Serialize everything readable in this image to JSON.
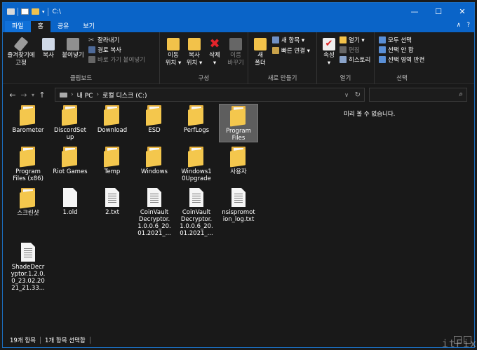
{
  "window": {
    "title": "C:\\",
    "controls": [
      "—",
      "☐",
      "✕"
    ]
  },
  "tabs": [
    {
      "label": "파일"
    },
    {
      "label": "홈"
    },
    {
      "label": "공유"
    },
    {
      "label": "보기"
    }
  ],
  "ribbon": {
    "clipboard": {
      "pin": "즐겨찾기에\n고정",
      "copy": "복사",
      "paste": "붙여넣기",
      "cut": "잘라내기",
      "copy_path": "경로 복사",
      "paste_shortcut": "바로 가기 붙여넣기",
      "label": "클립보드"
    },
    "organize": {
      "move_to": "이동\n위치 ▾",
      "copy_to": "복사\n위치 ▾",
      "delete": "삭제\n▾",
      "rename": "이름\n바꾸기",
      "label": "구성"
    },
    "new": {
      "new_folder": "새\n폴더",
      "new_item": "새 항목 ▾",
      "easy_access": "빠른 연결 ▾",
      "label": "새로 만들기"
    },
    "open": {
      "properties": "속성\n▾",
      "open": "열기 ▾",
      "edit": "편집",
      "history": "히스토리",
      "label": "열기"
    },
    "select": {
      "select_all": "모두 선택",
      "select_none": "선택 안 함",
      "invert": "선택 영역 반전",
      "label": "선택"
    }
  },
  "address": {
    "path_pc": "내 PC",
    "path_drive": "로컬 디스크 (C:)",
    "search_placeholder": ""
  },
  "items": [
    {
      "name": "Barometer",
      "type": "folder"
    },
    {
      "name": "DiscordSet\nup",
      "type": "folder"
    },
    {
      "name": "Download",
      "type": "folder"
    },
    {
      "name": "ESD",
      "type": "folder"
    },
    {
      "name": "PerfLogs",
      "type": "folder"
    },
    {
      "name": "Program\nFiles",
      "type": "folder",
      "selected": true
    },
    {
      "name": "Program\nFiles (x86)",
      "type": "folder"
    },
    {
      "name": "Riot Games",
      "type": "folder"
    },
    {
      "name": "Temp",
      "type": "folder"
    },
    {
      "name": "Windows",
      "type": "folder"
    },
    {
      "name": "Windows1\n0Upgrade",
      "type": "folder"
    },
    {
      "name": "사용자",
      "type": "folder"
    },
    {
      "name": "스크린샷",
      "type": "folder"
    },
    {
      "name": "1.old",
      "type": "file"
    },
    {
      "name": "2.txt",
      "type": "text"
    },
    {
      "name": "CoinVault\nDecryptor.\n1.0.0.6_20.\n01.2021_...",
      "type": "text"
    },
    {
      "name": "CoinVault\nDecryptor.\n1.0.0.6_20.\n01.2021_...",
      "type": "text"
    },
    {
      "name": "nsispromot\nion_log.txt",
      "type": "text"
    },
    {
      "name": "ShadeDecr\nyptor.1.2.0.\n0_23.02.20\n21_21.33...",
      "type": "text"
    }
  ],
  "preview_text": "미리 볼 수 없습니다.",
  "status": {
    "count": "19개 항목",
    "selected": "1개 항목 선택함"
  },
  "watermark": "itFix"
}
